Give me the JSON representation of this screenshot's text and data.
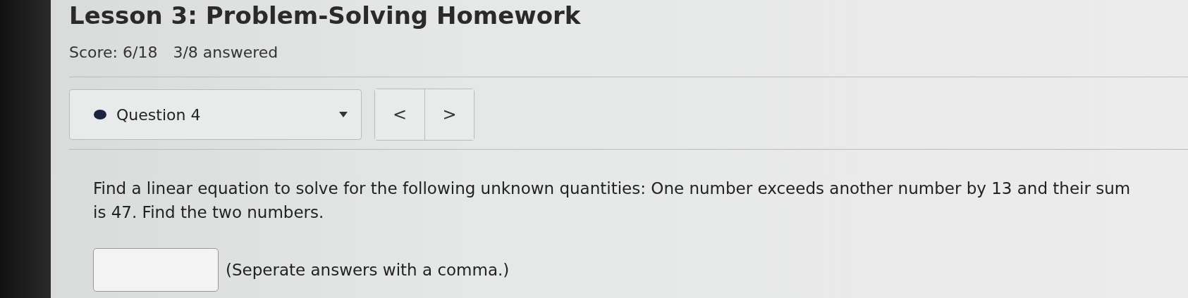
{
  "title": "Lesson 3: Problem-Solving Homework",
  "score": "Score: 6/18",
  "progress": "3/8 answered",
  "question_selector": {
    "label": "Question 4"
  },
  "nav_buttons": [
    "<",
    ">"
  ],
  "question": "Find a linear equation to solve for the following unknown quantities: One number exceeds another number by 13 and their sum is 47. Find the two numbers.",
  "answer": {
    "hint": "(Seperate answers with a comma.)"
  }
}
